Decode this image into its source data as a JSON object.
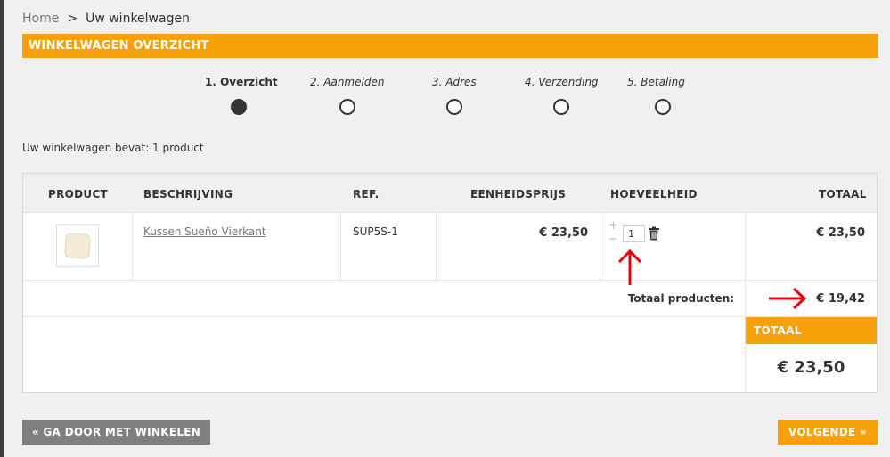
{
  "breadcrumb": {
    "home": "Home",
    "separator": ">",
    "current": "Uw winkelwagen"
  },
  "banner": {
    "title": "WINKELWAGEN OVERZICHT"
  },
  "steps": [
    {
      "label": "1. Overzicht",
      "active": true
    },
    {
      "label": "2. Aanmelden",
      "active": false
    },
    {
      "label": "3. Adres",
      "active": false
    },
    {
      "label": "4. Verzending",
      "active": false
    },
    {
      "label": "5. Betaling",
      "active": false
    }
  ],
  "cart_count": "Uw winkelwagen bevat: 1 product",
  "table": {
    "headers": {
      "product": "PRODUCT",
      "description": "BESCHRIJVING",
      "ref": "REF.",
      "unit_price": "EENHEIDSPRIJS",
      "quantity": "HOEVEELHEID",
      "total": "TOTAAL"
    },
    "rows": [
      {
        "description": "Kussen Sueño Vierkant",
        "ref": "SUP5S-1",
        "unit_price": "€ 23,50",
        "quantity": "1",
        "total": "€ 23,50",
        "plus": "+",
        "minus": "−",
        "thumbnail_icon": "pillow-image",
        "delete_icon": "trash-icon"
      }
    ],
    "total_products_label": "Totaal producten:",
    "total_products_value": "€ 19,42",
    "total_label": "TOTAAL",
    "grand_total": "€ 23,50"
  },
  "buttons": {
    "continue_shopping": "« GA DOOR MET WINKELEN",
    "next": "VOLGENDE »"
  },
  "colors": {
    "accent": "#f7a10a",
    "annotation_arrow": "#e8000b",
    "button_grey": "#7f7f7f"
  }
}
